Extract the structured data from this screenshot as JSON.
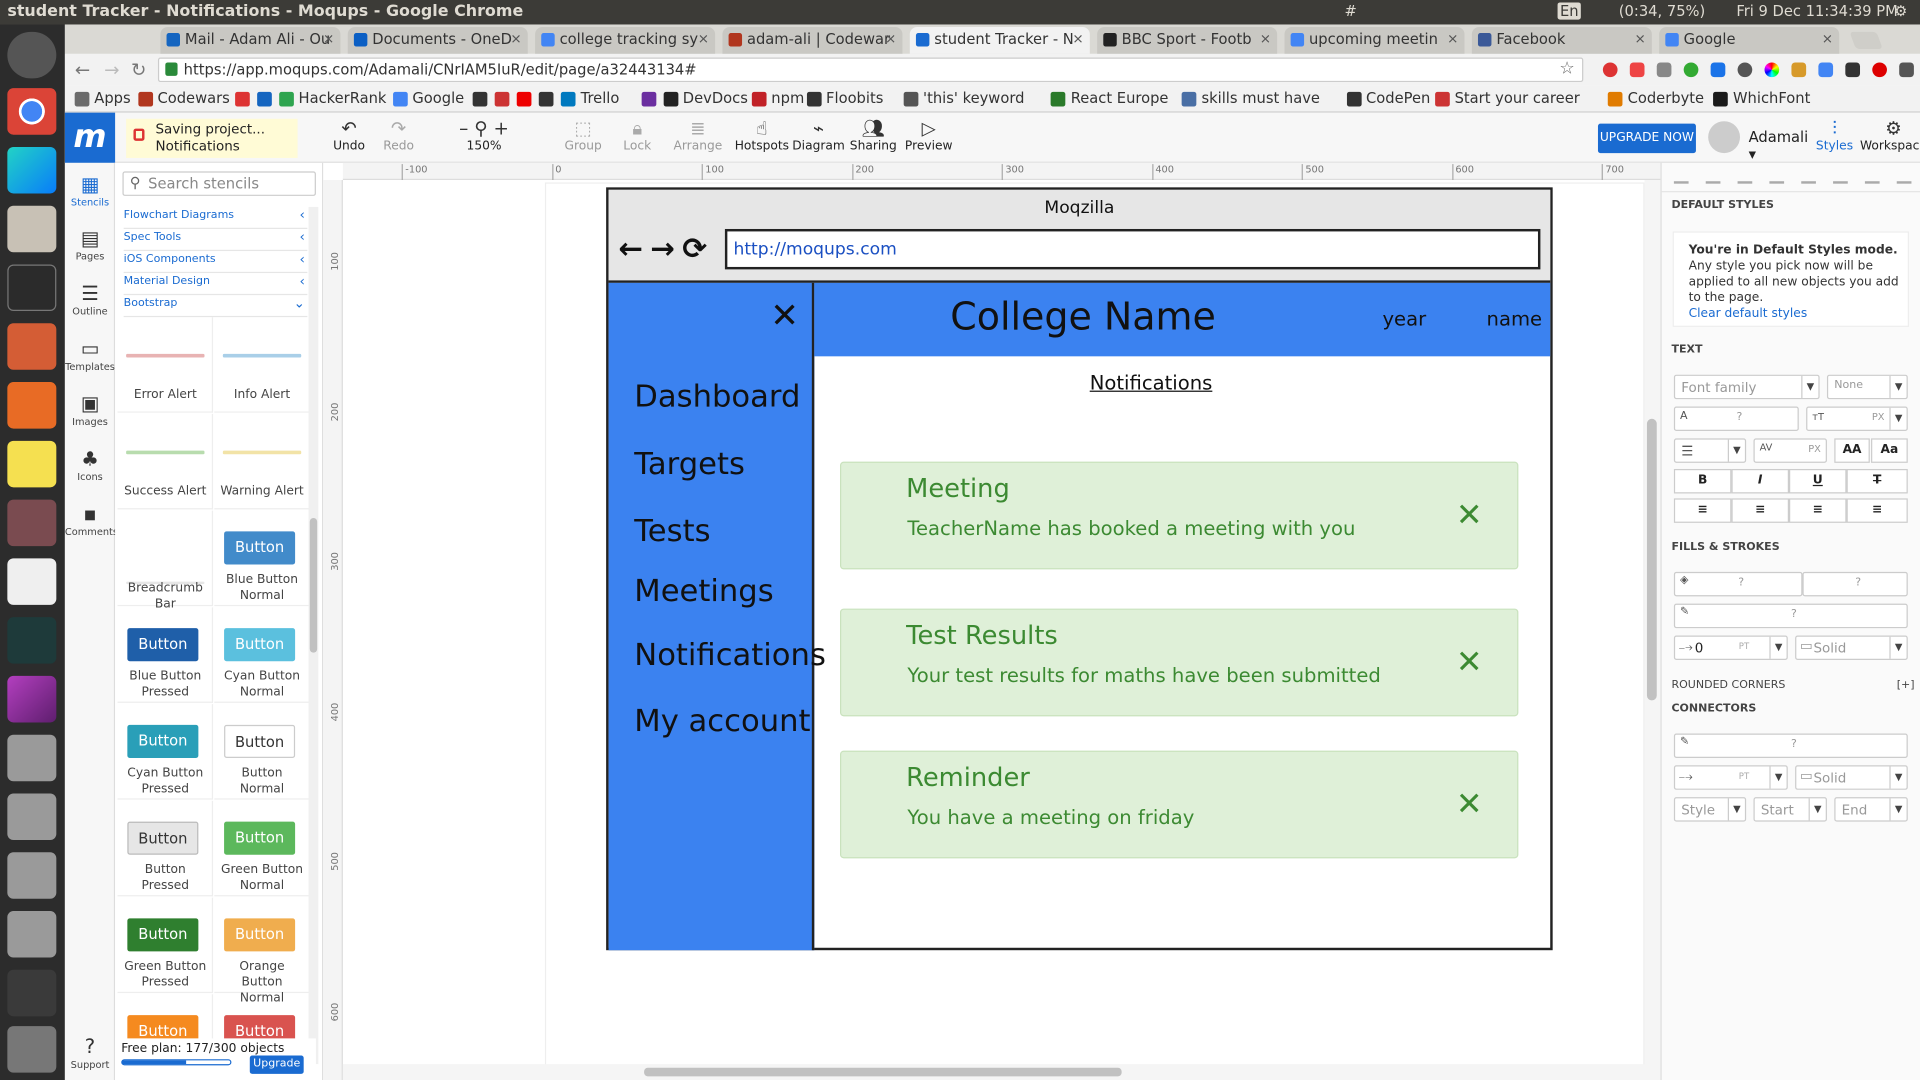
{
  "os": {
    "window_title": "student Tracker - Notifications - Moqups - Google Chrome",
    "indicators": [
      "#",
      "En",
      "(0:34, 75%)",
      "Fri 9 Dec 11:34:39 PM"
    ]
  },
  "browser": {
    "tabs": [
      {
        "label": "Mail - Adam Ali - Ou",
        "color": "#1565c0"
      },
      {
        "label": "Documents - OneD",
        "color": "#0b5fc4"
      },
      {
        "label": "college tracking sy",
        "color": "#4285f4"
      },
      {
        "label": "adam-ali | Codewar",
        "color": "#b1361e"
      },
      {
        "label": "student Tracker - N",
        "color": "#1a6bd1",
        "active": true
      },
      {
        "label": "BBC Sport - Footb",
        "color": "#222222"
      },
      {
        "label": "upcoming meetin",
        "color": "#4285f4"
      },
      {
        "label": "Facebook",
        "color": "#3b5998"
      },
      {
        "label": "Google",
        "color": "#4285f4"
      }
    ],
    "url": "https://app.moqups.com/Adamali/CNrIAM5IuR/edit/page/a32443134#",
    "bookmarks": [
      "Apps",
      "Codewars",
      "",
      "",
      "HackerRank",
      "Google",
      "",
      "",
      "",
      "",
      "Trello",
      "",
      "DevDocs",
      "npm",
      "Floobits",
      "'this' keyword",
      "React Europe",
      "skills must have",
      "CodePen",
      "Start your career",
      "Coderbyte",
      "WhichFont"
    ]
  },
  "moqups": {
    "logo": "m",
    "saving": {
      "line1": "Saving project...",
      "line2": "Notifications"
    },
    "toolbar": {
      "undo": "Undo",
      "redo": "Redo",
      "zoom": "150%",
      "group": "Group",
      "lock": "Lock",
      "arrange": "Arrange",
      "hotspots": "Hotspots",
      "diagram": "Diagram",
      "sharing": "Sharing",
      "preview": "Preview"
    },
    "upgrade_top": "UPGRADE NOW",
    "user": "Adamali",
    "styles": "Styles",
    "workspace": "Workspace",
    "rail": [
      "Stencils",
      "Pages",
      "Outline",
      "Templates",
      "Images",
      "Icons",
      "Comments",
      "Support"
    ],
    "search_placeholder": "Search stencils",
    "categories": [
      "Flowchart Diagrams",
      "Spec Tools",
      "iOS Components",
      "Material Design",
      "Bootstrap"
    ],
    "stencils": [
      {
        "label": "Error Alert"
      },
      {
        "label": "Info Alert"
      },
      {
        "label": "Success Alert"
      },
      {
        "label": "Warning Alert"
      },
      {
        "label": "Breadcrumb Bar"
      },
      {
        "label": "Blue Button Normal",
        "btn": "Button"
      },
      {
        "label": "Blue Button Pressed",
        "btn": "Button"
      },
      {
        "label": "Cyan Button Normal",
        "btn": "Button"
      },
      {
        "label": "Cyan Button Pressed",
        "btn": "Button"
      },
      {
        "label": "Button Normal",
        "btn": "Button"
      },
      {
        "label": "Button Pressed",
        "btn": "Button"
      },
      {
        "label": "Green Button Normal",
        "btn": "Button"
      },
      {
        "label": "Green Button Pressed",
        "btn": "Button"
      },
      {
        "label": "Orange Button Normal",
        "btn": "Button"
      },
      {
        "label": "",
        "btn": "Button"
      },
      {
        "label": "",
        "btn": "Button"
      }
    ],
    "free_plan": "Free plan: 177/300 objects",
    "free_plan_fraction": 0.59,
    "upgrade_small": "Upgrade",
    "ruler_h": [
      "-100",
      "0",
      "100",
      "200",
      "300",
      "400",
      "500",
      "600",
      "700"
    ],
    "ruler_v": [
      "100",
      "200",
      "300",
      "400",
      "500",
      "600"
    ]
  },
  "mockup": {
    "browser_title": "Moqzilla",
    "nav": "←→⟳",
    "url": "http://moqups.com",
    "close": "✕",
    "sidebar": [
      "Dashboard",
      "Targets",
      "Tests",
      "Meetings",
      "Notifications",
      "My account"
    ],
    "college_name": "College Name",
    "year": "year",
    "name": "name",
    "page_title": "Notifications",
    "cards": [
      {
        "title": "Meeting",
        "message": "TeacherName has booked a meeting with you"
      },
      {
        "title": "Test Results",
        "message": "Your test results for maths have been submitted"
      },
      {
        "title": "Reminder",
        "message": "You have a meeting on friday"
      }
    ]
  },
  "right_panel": {
    "default_styles": "DEFAULT STYLES",
    "default_mode_title": "You're in Default Styles mode.",
    "default_mode_text": "Any style you pick now will be applied to all new objects you add to the page.",
    "clear_link": "Clear default styles",
    "text_header": "TEXT",
    "font_family": "Font family",
    "font_none": "None",
    "q": "?",
    "px": "PX",
    "pt": "PT",
    "fills_header": "FILLS & STROKES",
    "stroke_width": "0",
    "solid": "Solid",
    "rounded": "ROUNDED CORNERS",
    "rounded_add": "[+]",
    "connectors": "CONNECTORS",
    "style": "Style",
    "start": "Start",
    "end": "End",
    "bold": "B",
    "italic": "I",
    "underline": "U",
    "strike": "T",
    "caps": "AA",
    "capsmall": "Aa"
  }
}
